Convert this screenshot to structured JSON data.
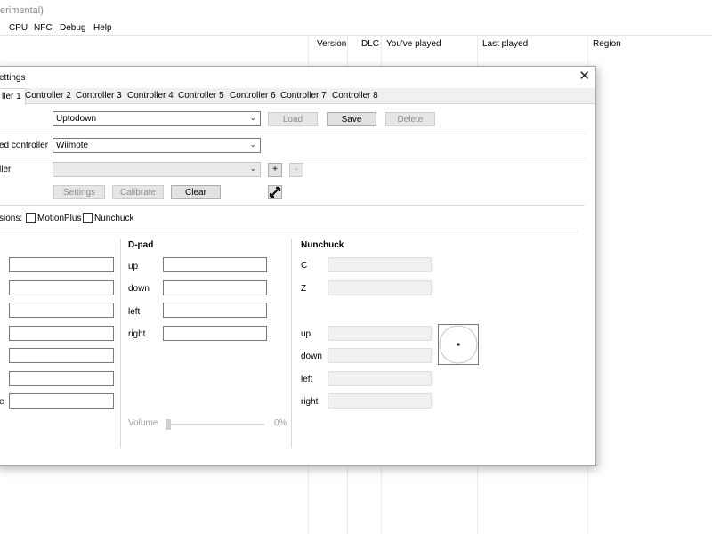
{
  "app": {
    "title_fragment": "erimental)",
    "menu": [
      "CPU",
      "NFC",
      "Debug",
      "Help"
    ],
    "columns": [
      "Version",
      "DLC",
      "You've played",
      "Last played",
      "Region"
    ]
  },
  "dialog": {
    "title": "ettings",
    "close": "✕",
    "tabs": [
      "ller 1",
      "Controller 2",
      "Controller 3",
      "Controller 4",
      "Controller 5",
      "Controller 6",
      "Controller 7",
      "Controller 8"
    ],
    "profile": {
      "value": "Uptodown",
      "load": "Load",
      "save": "Save",
      "delete": "Delete"
    },
    "emulated": {
      "label": "ed controller",
      "value": "Wiimote"
    },
    "input_device": {
      "label": "ller",
      "value": "",
      "add": "+",
      "remove": "-",
      "settings": "Settings",
      "calibrate": "Calibrate",
      "clear": "Clear"
    },
    "extensions": {
      "label": "sions:",
      "motionplus": "MotionPlus",
      "nunchuck": "Nunchuck"
    },
    "left_group_last_label": "e",
    "dpad": {
      "title": "D-pad",
      "labels": [
        "up",
        "down",
        "left",
        "right"
      ],
      "volume_label": "Volume",
      "volume_value": "0%"
    },
    "nunchuck": {
      "title": "Nunchuck",
      "buttons": [
        "C",
        "Z"
      ],
      "stick": [
        "up",
        "down",
        "left",
        "right"
      ]
    }
  },
  "colors": {
    "accent_border": "#7a7a7a",
    "disabled_text": "#8d8d8d"
  },
  "icons": {
    "close": "close-icon",
    "dropdown": "chevron-down-icon",
    "motion": "motion-move-icon"
  }
}
